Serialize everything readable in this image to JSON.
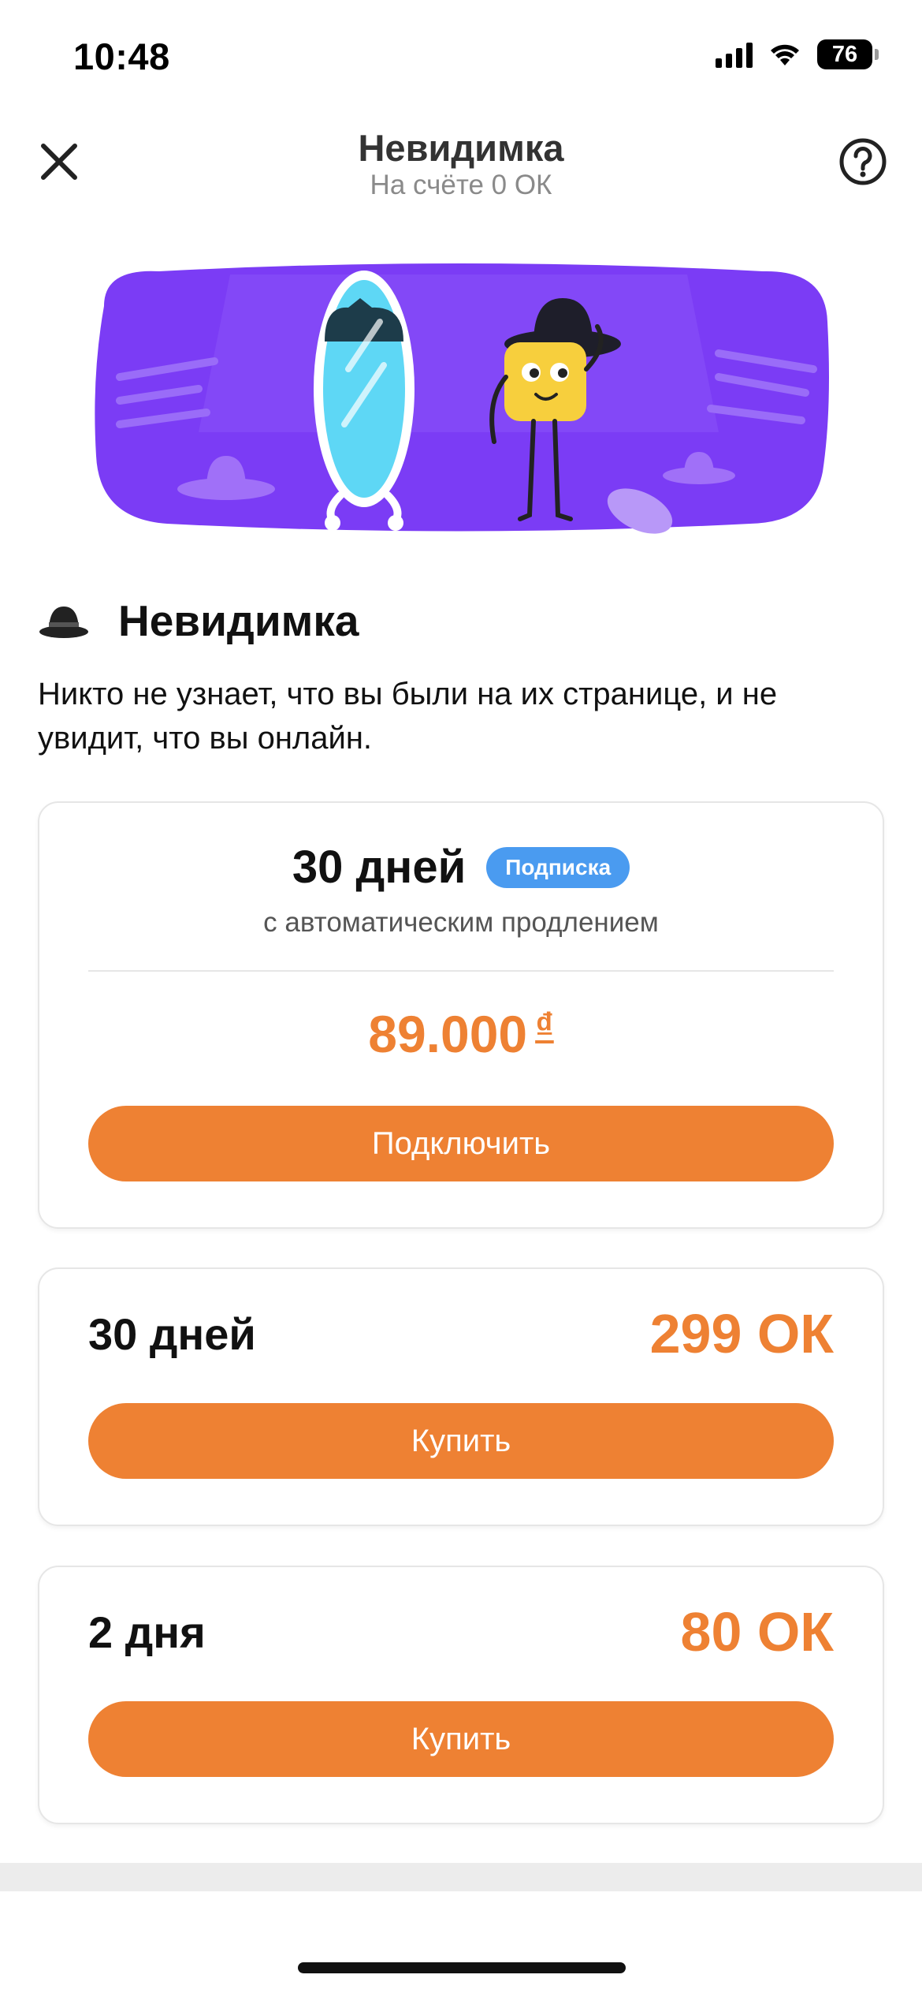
{
  "status_bar": {
    "time": "10:48",
    "battery": "76"
  },
  "header": {
    "title": "Невидимка",
    "subtitle": "На счёте 0 ОК"
  },
  "section": {
    "title": "Невидимка",
    "icon": "hat-icon",
    "description": "Никто не узнает, что вы были на их странице, и не увидит, что вы онлайн."
  },
  "subscription": {
    "period": "30 дней",
    "badge": "Подписка",
    "note": "с автоматическим продлением",
    "price": "89.000",
    "currency": "₫",
    "button": "Подключить"
  },
  "options": [
    {
      "period": "30 дней",
      "price": "299 ОК",
      "button": "Купить"
    },
    {
      "period": "2 дня",
      "price": "80 ОК",
      "button": "Купить"
    }
  ],
  "colors": {
    "accent": "#ee8133",
    "badge": "#4a9bf0",
    "banner": "#7b3cf5"
  }
}
